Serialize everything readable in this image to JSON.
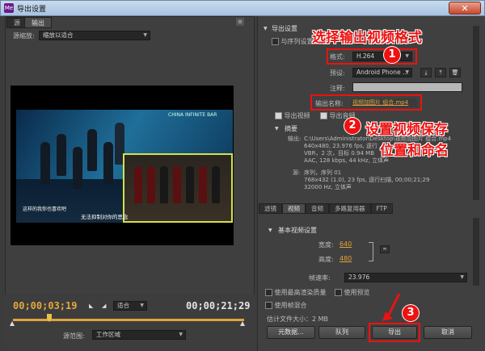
{
  "window": {
    "title": "导出设置",
    "close": "✕",
    "app_icon": "adobe-media-encoder-icon"
  },
  "left": {
    "tabs": [
      "源",
      "输出"
    ],
    "source_scale_label": "源缩放:",
    "source_scale_value": "缩放以适合",
    "video_text": {
      "brand": "CHINA INFINITE BAR",
      "subtitle": "无法抑制对你的思念",
      "left_caption": "这样的我你也喜欢吧"
    },
    "timecode_current": "00;00;03;19",
    "timecode_total": "00;00;21;29",
    "fit_value": "适合",
    "source_range_label": "源范围:",
    "source_range_value": "工作区域"
  },
  "right": {
    "export_settings_label": "导出设置",
    "match_sequence_label": "与序列设置匹配",
    "format_label": "格式:",
    "format_value": "H.264",
    "preset_label": "预设:",
    "preset_value": "Android Phone ...",
    "comment_label": "注释:",
    "output_name_label": "输出名称:",
    "output_name_value": "视频加图片 组合.mp4",
    "export_video_label": "导出视频",
    "export_audio_label": "导出音频",
    "summary_label": "摘要",
    "output_label": "输出:",
    "output_lines": [
      "C:\\Users\\Administrator\\Desktop\\视频加图片 组合.mp4",
      "640x480, 23.976 fps, 逐行",
      "VBR，2 次，目标 0.94 MB",
      "AAC, 128 kbps, 44 kHz, 立体声"
    ],
    "source_label": "源:",
    "source_lines": [
      "序列，序列 01",
      "768x432 (1.0), 23 fps, 逐行扫描, 00;00;21;29",
      "32000 Hz, 立体声"
    ],
    "subtabs": [
      "滤镜",
      "视频",
      "音频",
      "多路复用器",
      "FTP"
    ],
    "basic_video_label": "基本视频设置",
    "width_label": "宽度:",
    "width_value": "640",
    "height_label": "高度:",
    "height_value": "480",
    "framerate_label": "帧速率:",
    "framerate_value": "23.976",
    "max_render_label": "使用最高渲染质量",
    "use_preview_label": "使用预览",
    "use_blend_label": "使用帧混合",
    "est_size_label": "估计文件大小：",
    "est_size_value": "2 MB",
    "buttons": {
      "metadata": "元数据...",
      "queue": "队列",
      "export": "导出",
      "cancel": "取消"
    }
  },
  "annotations": {
    "step1": "1",
    "step1_text": "选择输出视频格式",
    "step2": "2",
    "step2_text_a": "设置视频保存",
    "step2_text_b": "位置和命名",
    "step3": "3"
  },
  "colors": {
    "accent_orange": "#e3a33a",
    "annotation_red": "#e11111"
  }
}
